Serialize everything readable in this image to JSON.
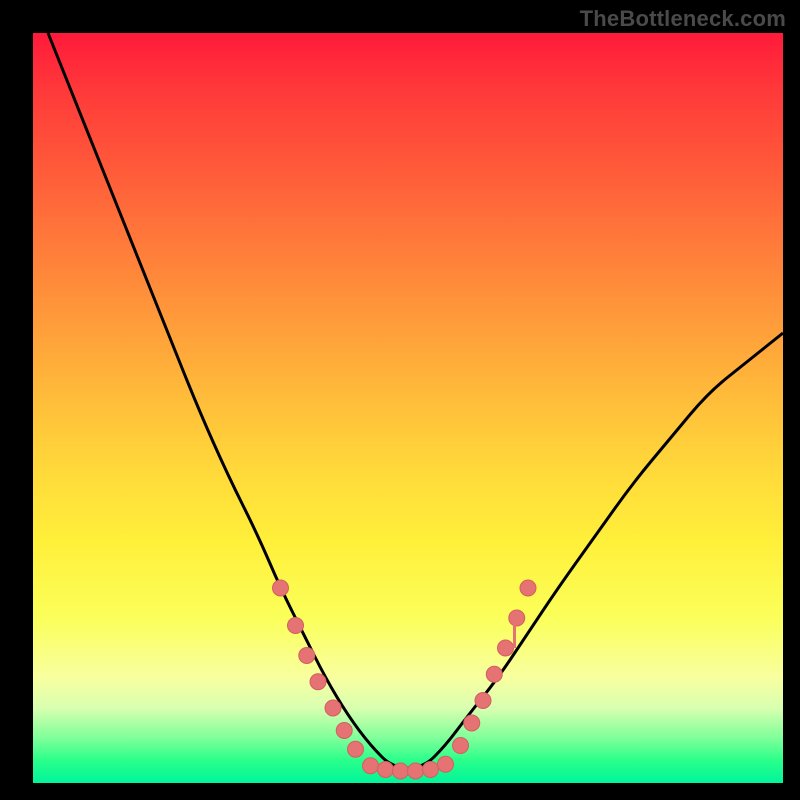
{
  "watermark": "TheBottleneck.com",
  "colors": {
    "page_bg": "#000000",
    "curve": "#000000",
    "marker_fill": "#e57373",
    "marker_stroke": "#d45f5f"
  },
  "chart_data": {
    "type": "line",
    "title": "",
    "xlabel": "",
    "ylabel": "",
    "xlim": [
      0,
      100
    ],
    "ylim": [
      0,
      100
    ],
    "grid": false,
    "legend": false,
    "series": [
      {
        "name": "bottleneck-curve",
        "x": [
          2,
          6,
          10,
          14,
          18,
          22,
          26,
          30,
          33,
          36,
          39,
          42,
          45,
          48,
          52,
          55,
          58,
          62,
          66,
          70,
          75,
          80,
          85,
          90,
          95,
          100
        ],
        "y": [
          100,
          90,
          80,
          70,
          60,
          50,
          41,
          33,
          26,
          20,
          14,
          9,
          5,
          2,
          2,
          5,
          9,
          14,
          20,
          26,
          33,
          40,
          46,
          52,
          56,
          60
        ]
      }
    ],
    "markers": [
      {
        "x": 33,
        "y": 26
      },
      {
        "x": 35,
        "y": 21
      },
      {
        "x": 36.5,
        "y": 17
      },
      {
        "x": 38,
        "y": 13.5
      },
      {
        "x": 40,
        "y": 10
      },
      {
        "x": 41.5,
        "y": 7
      },
      {
        "x": 43,
        "y": 4.5
      },
      {
        "x": 45,
        "y": 2.3
      },
      {
        "x": 47,
        "y": 1.8
      },
      {
        "x": 49,
        "y": 1.6
      },
      {
        "x": 51,
        "y": 1.6
      },
      {
        "x": 53,
        "y": 1.8
      },
      {
        "x": 55,
        "y": 2.5
      },
      {
        "x": 57,
        "y": 5
      },
      {
        "x": 58.5,
        "y": 8
      },
      {
        "x": 60,
        "y": 11
      },
      {
        "x": 61.5,
        "y": 14.5
      },
      {
        "x": 63,
        "y": 18
      },
      {
        "x": 64.5,
        "y": 22
      },
      {
        "x": 66,
        "y": 26
      }
    ],
    "notch_segments": [
      {
        "x": 64.2,
        "y0": 18,
        "y1": 22
      }
    ]
  }
}
